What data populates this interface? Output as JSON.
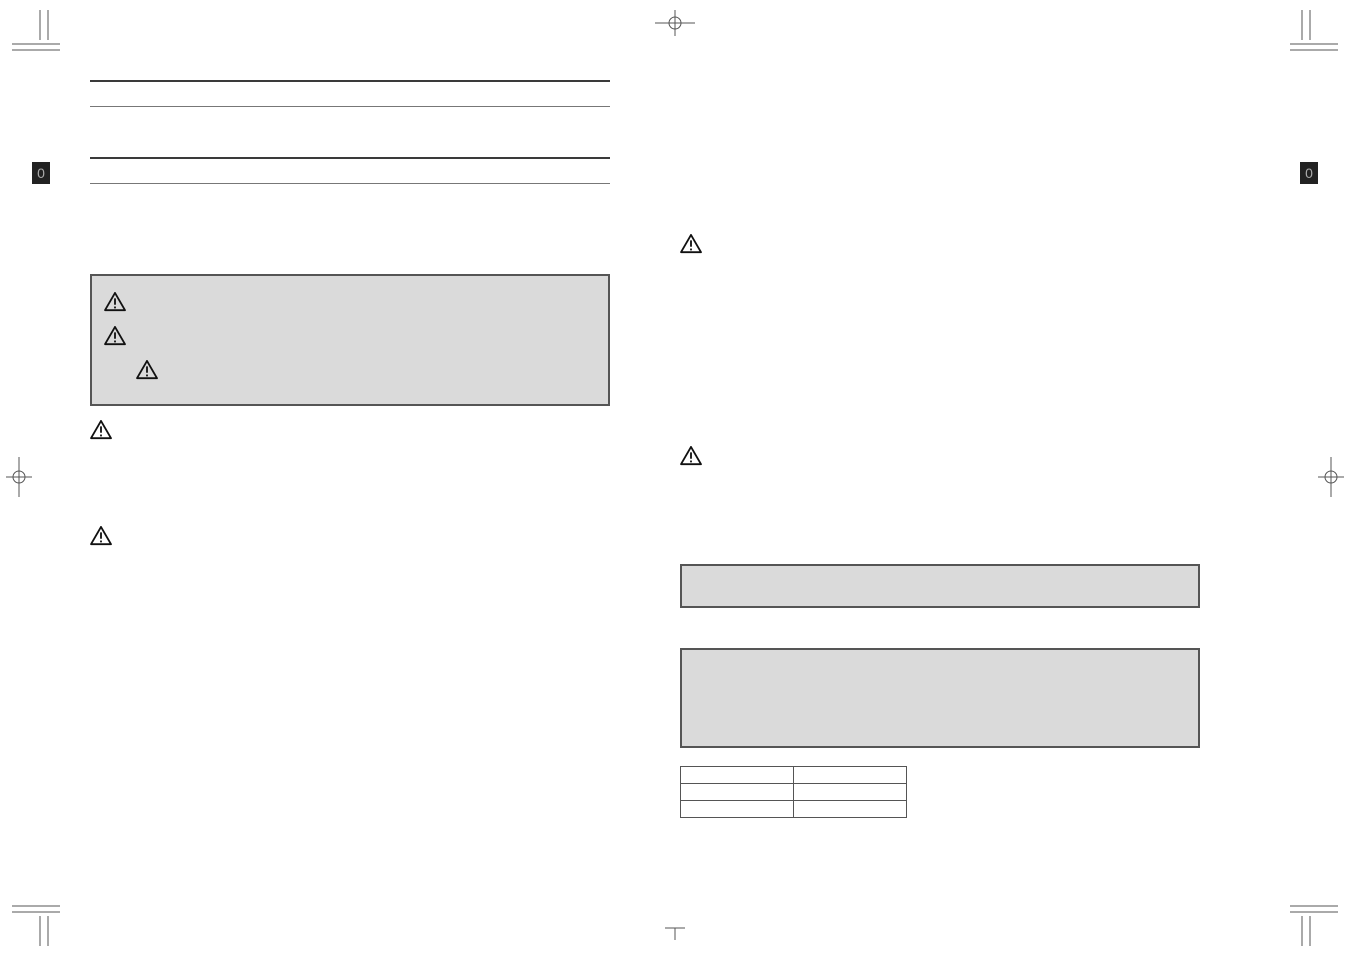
{
  "side_tabs": {
    "left": "0",
    "right": "0"
  },
  "left_column": {
    "callout": {
      "rows": [
        {
          "icon": "warning-icon",
          "indent": false
        },
        {
          "icon": "warning-icon",
          "indent": false
        },
        {
          "icon": "warning-icon",
          "indent": true
        }
      ]
    },
    "paragraph_warnings": [
      {
        "icon": "warning-icon"
      },
      {
        "icon": "warning-icon"
      }
    ]
  },
  "right_column": {
    "paragraph_warnings": [
      {
        "icon": "warning-icon"
      },
      {
        "icon": "warning-icon"
      }
    ],
    "table": {
      "rows": 3,
      "cols": 2
    }
  }
}
